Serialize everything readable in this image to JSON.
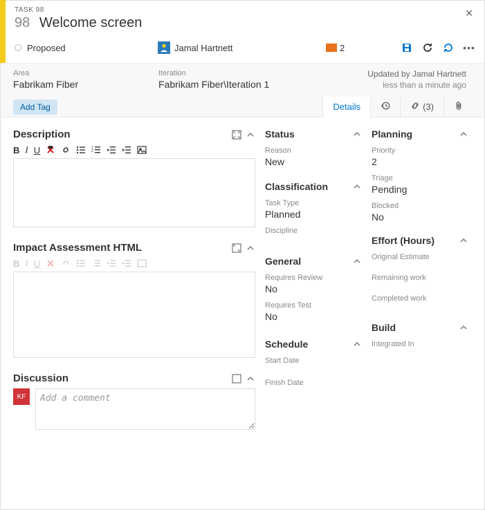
{
  "header": {
    "task_label": "TASK 98",
    "id": "98",
    "title": "Welcome screen",
    "state": "Proposed",
    "assignee": "Jamal Hartnett",
    "comment_count": "2"
  },
  "info": {
    "area_label": "Area",
    "area_value": "Fabrikam Fiber",
    "iteration_label": "Iteration",
    "iteration_value": "Fabrikam Fiber\\Iteration 1",
    "updated_by": "Updated by Jamal Hartnett",
    "updated_time": "less than a minute ago"
  },
  "tags": {
    "add_tag": "Add Tag"
  },
  "tabs": {
    "details": "Details",
    "links": "(3)"
  },
  "sections": {
    "description": "Description",
    "impact": "Impact Assessment HTML",
    "discussion": "Discussion",
    "status": "Status",
    "classification": "Classification",
    "general": "General",
    "schedule": "Schedule",
    "planning": "Planning",
    "effort": "Effort (Hours)",
    "build": "Build"
  },
  "fields": {
    "reason_label": "Reason",
    "reason_value": "New",
    "tasktype_label": "Task Type",
    "tasktype_value": "Planned",
    "discipline_label": "Discipline",
    "discipline_value": "",
    "reqreview_label": "Requires Review",
    "reqreview_value": "No",
    "reqtest_label": "Requires Test",
    "reqtest_value": "No",
    "startdate_label": "Start Date",
    "startdate_value": "",
    "finishdate_label": "Finish Date",
    "finishdate_value": "",
    "priority_label": "Priority",
    "priority_value": "2",
    "triage_label": "Triage",
    "triage_value": "Pending",
    "blocked_label": "Blocked",
    "blocked_value": "No",
    "origest_label": "Original Estimate",
    "origest_value": "",
    "remaining_label": "Remaining work",
    "remaining_value": "",
    "completed_label": "Completed work",
    "completed_value": "",
    "integrated_label": "Integrated In",
    "integrated_value": ""
  },
  "discussion": {
    "user_initials": "KF",
    "placeholder": "Add a comment"
  }
}
